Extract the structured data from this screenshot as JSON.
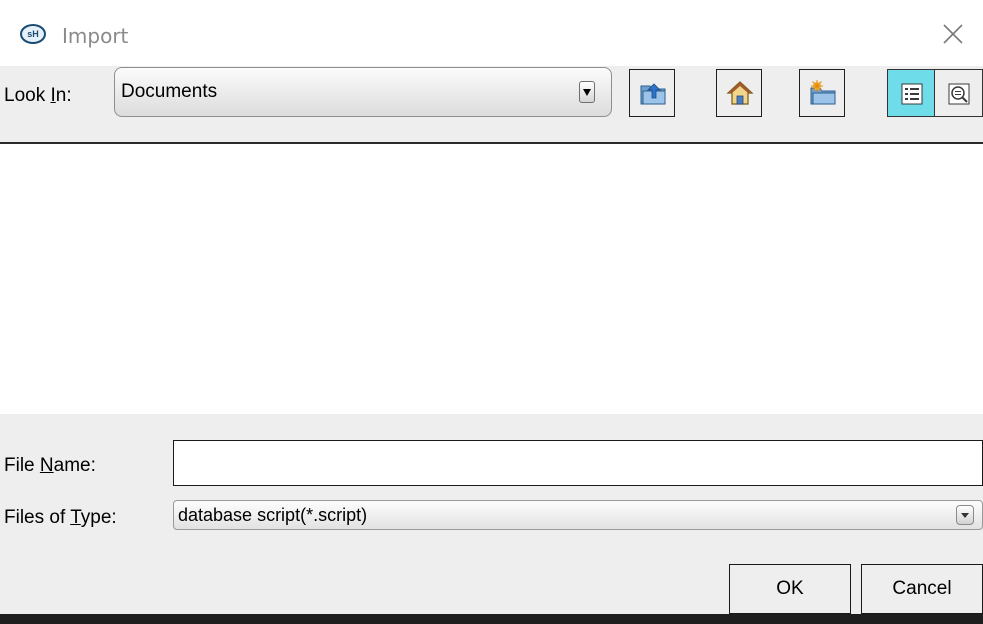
{
  "window": {
    "title": "Import",
    "app_icon_text": "sH",
    "close_icon": "close-icon"
  },
  "toolbar": {
    "look_in_label_prefix": "Look ",
    "look_in_label_mnemonic": "I",
    "look_in_label_suffix": "n:",
    "look_in_value": "Documents",
    "up_folder_icon": "up-one-level-icon",
    "home_icon": "home-icon",
    "new_folder_icon": "new-folder-icon",
    "list_view_icon": "list-view-icon",
    "details_view_icon": "details-view-icon",
    "active_view": "list"
  },
  "file_list": {
    "items": []
  },
  "bottom": {
    "file_name_label_prefix": "File ",
    "file_name_label_mnemonic": "N",
    "file_name_label_suffix": "ame:",
    "file_name_value": "",
    "files_of_type_label_prefix": "Files of ",
    "files_of_type_label_mnemonic": "T",
    "files_of_type_label_suffix": "ype:",
    "files_of_type_value": "database script(*.script)",
    "ok_label": "OK",
    "cancel_label": "Cancel"
  },
  "colors": {
    "background": "#eeeeee",
    "list_background": "#ffffff",
    "active_view_toggle": "#6fdcea",
    "title_text": "#8a8a8a"
  }
}
